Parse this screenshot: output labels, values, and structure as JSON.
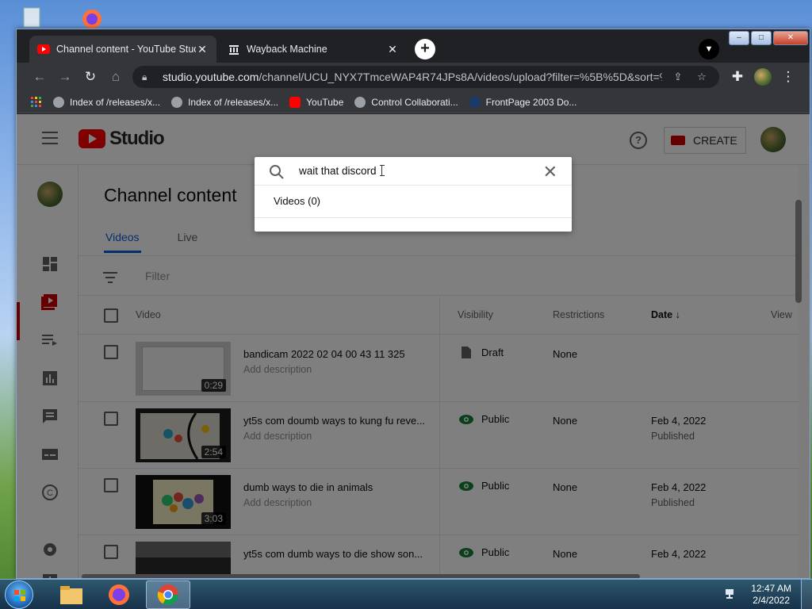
{
  "browser": {
    "tabs": [
      {
        "title": "Channel content - YouTube Studio",
        "active": true
      },
      {
        "title": "Wayback Machine",
        "active": false
      }
    ],
    "url_host": "studio.youtube.com",
    "url_path": "/channel/UCU_NYX7TmceWAP4R74JPs8A/videos/upload?filter=%5B%5D&sort=%...",
    "bookmarks": [
      "Index of /releases/x...",
      "Index of /releases/x...",
      "YouTube",
      "Control Collaborati...",
      "FrontPage 2003 Do..."
    ]
  },
  "studio": {
    "logo_text": "Studio",
    "create_label": "CREATE",
    "page_title": "Channel content",
    "tabs": [
      "Videos",
      "Live"
    ],
    "filter_placeholder": "Filter",
    "columns": {
      "video": "Video",
      "visibility": "Visibility",
      "restrictions": "Restrictions",
      "date": "Date",
      "views": "View"
    }
  },
  "search": {
    "value": "wait that discord",
    "result": "Videos (0)"
  },
  "videos": [
    {
      "title": "bandicam 2022 02 04 00 43 11 325",
      "desc": "Add description",
      "duration": "0:29",
      "visibility": "Draft",
      "restrictions": "None",
      "date": "",
      "date_sub": ""
    },
    {
      "title": "yt5s com doumb ways to kung fu reve...",
      "desc": "Add description",
      "duration": "2:54",
      "visibility": "Public",
      "restrictions": "None",
      "date": "Feb 4, 2022",
      "date_sub": "Published"
    },
    {
      "title": "dumb ways to die in animals",
      "desc": "Add description",
      "duration": "3:03",
      "visibility": "Public",
      "restrictions": "None",
      "date": "Feb 4, 2022",
      "date_sub": "Published"
    },
    {
      "title": "yt5s com dumb ways to die show son...",
      "desc": "",
      "duration": "",
      "visibility": "Public",
      "restrictions": "None",
      "date": "Feb 4, 2022",
      "date_sub": ""
    }
  ],
  "taskbar": {
    "time": "12:47 AM",
    "date": "2/4/2022"
  },
  "colors": {
    "youtube_red": "#ff0000",
    "link_blue": "#065fd4",
    "public_green": "#188038"
  }
}
